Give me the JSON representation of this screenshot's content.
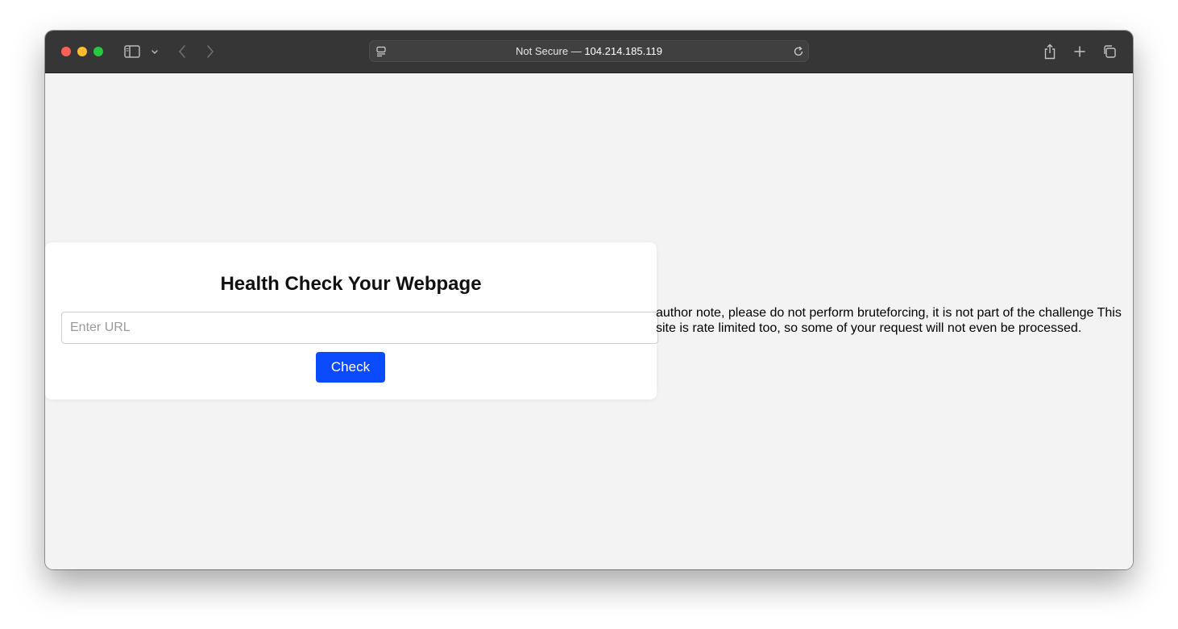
{
  "browser": {
    "address_prefix": "Not Secure — ",
    "address_host": "104.214.185.119",
    "icons": [
      "sidebar-icon",
      "chevron-down-icon",
      "back-icon",
      "forward-icon",
      "page-menu-icon",
      "reload-icon",
      "share-icon",
      "new-tab-icon",
      "tab-overview-icon"
    ]
  },
  "page": {
    "title": "Health Check Your Webpage",
    "url_placeholder": "Enter URL",
    "check_label": "Check",
    "note": "author note, please do not perform bruteforcing, it is not part of the challenge This site is rate limited too, so some of your request will not even be processed."
  },
  "colors": {
    "button": "#0a4bff",
    "page_background": "#f3f3f3",
    "titlebar": "#363636"
  }
}
